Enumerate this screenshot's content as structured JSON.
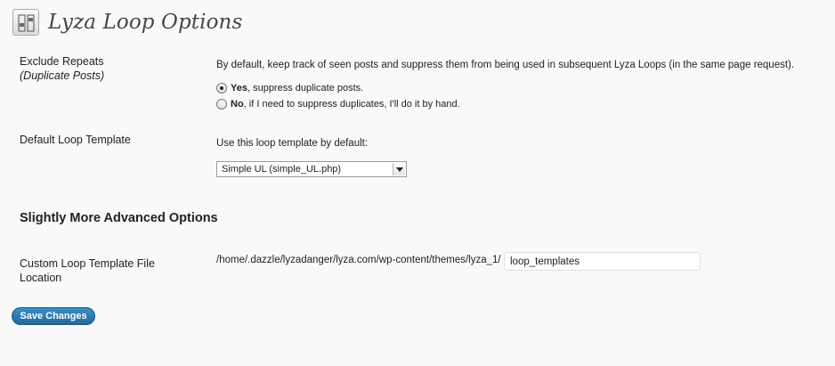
{
  "page": {
    "title": "Lyza Loop Options",
    "icon": "settings-sliders-icon"
  },
  "exclude_repeats": {
    "label": "Exclude Repeats",
    "sublabel": "(Duplicate Posts)",
    "description": "By default, keep track of seen posts and suppress them from being used in subsequent Lyza Loops (in the same page request).",
    "options": [
      {
        "bold": "Yes",
        "text": ", suppress duplicate posts.",
        "checked": true
      },
      {
        "bold": "No",
        "text": ", if I need to suppress duplicates, I'll do it by hand.",
        "checked": false
      }
    ]
  },
  "default_template": {
    "label": "Default Loop Template",
    "description": "Use this loop template by default:",
    "selected": "Simple UL (simple_UL.php)"
  },
  "advanced": {
    "heading": "Slightly More Advanced Options"
  },
  "template_location": {
    "label_line1": "Custom Loop Template File",
    "label_line2": "Location",
    "path_prefix": "/home/.dazzle/lyzadanger/lyza.com/wp-content/themes/lyza_1/",
    "value": "loop_templates"
  },
  "actions": {
    "save_label": "Save Changes",
    "accent_color": "#21689b"
  }
}
